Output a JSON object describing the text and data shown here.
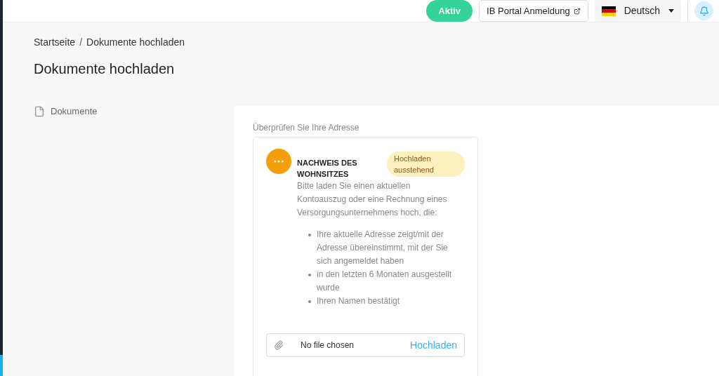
{
  "topbar": {
    "status": "Aktiv",
    "portal_link": "IB Portal Anmeldung",
    "language": "Deutsch"
  },
  "breadcrumb": [
    "Startseite",
    "Dokumente hochladen"
  ],
  "breadcrumb_separator": "/",
  "page_title": "Dokumente hochladen",
  "sidebar": {
    "items": [
      {
        "label": "Dokumente"
      }
    ]
  },
  "section": {
    "label": "Überprüfen Sie Ihre Adresse",
    "document": {
      "title": "NACHWEIS DES WOHNSITZES",
      "badge": "Hochladen ausstehend",
      "description": "Bitte laden Sie einen aktuellen Kontoauszug oder eine Rechnung eines Versorgungsunternehmens hoch, die:",
      "requirements": [
        "Ihre aktuelle Adresse zeigt/mit der Adresse übereinstimmt, mit der Sie sich angemeldet haben",
        "in den letzten 6 Monaten ausgestellt wurde",
        "Ihren Namen bestätigt"
      ],
      "file": {
        "value": "No file chosen",
        "button": "Hochladen"
      }
    }
  }
}
